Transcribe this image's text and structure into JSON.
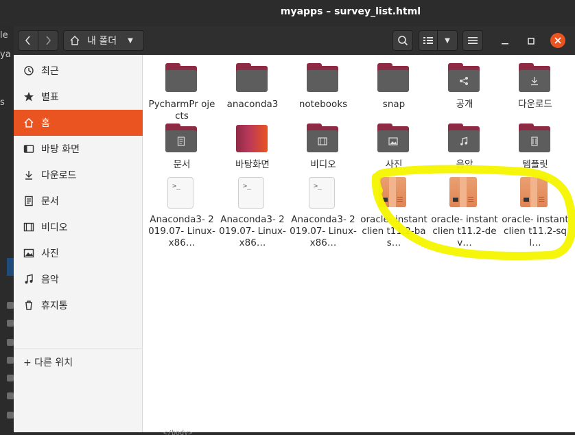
{
  "window": {
    "title": "myapps – survey_list.html"
  },
  "background": {
    "left_fragments": [
      "le",
      "ya",
      "s"
    ],
    "bottom_code": "</body>"
  },
  "header": {
    "path_label": "내 폴더",
    "icons": {
      "back": "chevron-left-icon",
      "forward": "chevron-right-icon",
      "home": "home-icon",
      "search": "search-icon",
      "view": "list-view-icon",
      "menu": "hamburger-menu-icon",
      "minimize": "minimize-icon",
      "maximize": "maximize-icon",
      "close": "close-icon"
    }
  },
  "sidebar": {
    "items": [
      {
        "label": "최근",
        "icon": "clock-icon"
      },
      {
        "label": "별표",
        "icon": "star-icon"
      },
      {
        "label": "홈",
        "icon": "home-icon",
        "active": true
      },
      {
        "label": "바탕 화면",
        "icon": "desktop-icon"
      },
      {
        "label": "다운로드",
        "icon": "download-icon"
      },
      {
        "label": "문서",
        "icon": "document-icon"
      },
      {
        "label": "비디오",
        "icon": "video-icon"
      },
      {
        "label": "사진",
        "icon": "picture-icon"
      },
      {
        "label": "음악",
        "icon": "music-icon"
      },
      {
        "label": "휴지통",
        "icon": "trash-icon"
      }
    ],
    "other_locations": "+ 다른 위치"
  },
  "files": [
    {
      "name": "PycharmProjects",
      "display": "PycharmPr ojects",
      "kind": "folder"
    },
    {
      "name": "anaconda3",
      "display": "anaconda3",
      "kind": "folder"
    },
    {
      "name": "notebooks",
      "display": "notebooks",
      "kind": "folder"
    },
    {
      "name": "snap",
      "display": "snap",
      "kind": "folder"
    },
    {
      "name": "공개",
      "display": "공개",
      "kind": "folder",
      "glyph": "share-icon"
    },
    {
      "name": "다운로드",
      "display": "다운로드",
      "kind": "folder",
      "glyph": "download-icon"
    },
    {
      "name": "문서",
      "display": "문서",
      "kind": "folder",
      "glyph": "document-icon"
    },
    {
      "name": "바탕화면",
      "display": "바탕화면",
      "kind": "desktop-folder"
    },
    {
      "name": "비디오",
      "display": "비디오",
      "kind": "folder",
      "glyph": "video-icon"
    },
    {
      "name": "사진",
      "display": "사진",
      "kind": "folder",
      "glyph": "picture-icon"
    },
    {
      "name": "음악",
      "display": "음악",
      "kind": "folder",
      "glyph": "music-icon"
    },
    {
      "name": "템플릿",
      "display": "템플릿",
      "kind": "folder",
      "glyph": "template-icon"
    },
    {
      "name": "Anaconda3-2019.07-Linux-x86...",
      "display": "Anaconda3- 2019.07- Linux-x86…",
      "kind": "script"
    },
    {
      "name": "Anaconda3-2019.07-Linux-x86...",
      "display": "Anaconda3- 2019.07- Linux-x86…",
      "kind": "script"
    },
    {
      "name": "Anaconda3-2019.07-Linux-x86...",
      "display": "Anaconda3- 2019.07- Linux-x86…",
      "kind": "script"
    },
    {
      "name": "oracle-instantclient11.2-bas...",
      "display": "oracle- instantclien t11.2-bas…",
      "kind": "package"
    },
    {
      "name": "oracle-instantclient11.2-dev...",
      "display": "oracle- instantclien t11.2-dev…",
      "kind": "package"
    },
    {
      "name": "oracle-instantclient11.2-sql...",
      "display": "oracle- instantclien t11.2-sql…",
      "kind": "package"
    }
  ],
  "colors": {
    "accent": "#e95420",
    "folder_tab": "#8f2a45",
    "folder_body": "#5d5d5d",
    "highlight": "#f5f500"
  }
}
